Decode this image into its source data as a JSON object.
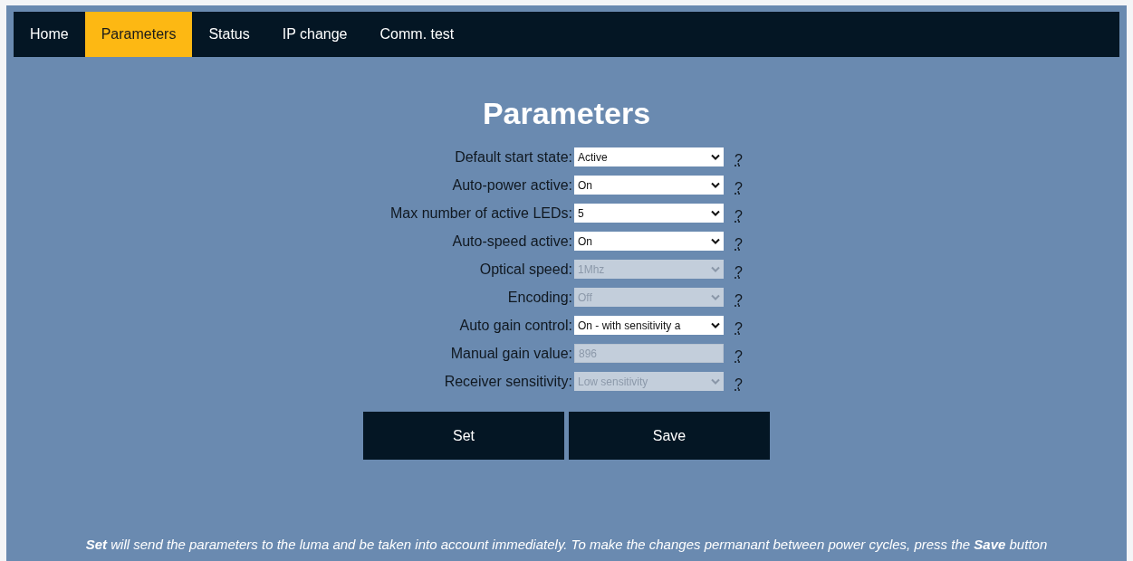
{
  "nav": [
    {
      "label": "Home",
      "selected": false
    },
    {
      "label": "Parameters",
      "selected": true
    },
    {
      "label": "Status",
      "selected": false
    },
    {
      "label": "IP change",
      "selected": false
    },
    {
      "label": "Comm. test",
      "selected": false
    }
  ],
  "title": "Parameters",
  "fields": [
    {
      "label": "Default start state:",
      "kind": "select",
      "value": "Active",
      "disabled": false,
      "help": "?"
    },
    {
      "label": "Auto-power active:",
      "kind": "select",
      "value": "On",
      "disabled": false,
      "help": "?"
    },
    {
      "label": "Max number of active LEDs:",
      "kind": "select",
      "value": "5",
      "disabled": false,
      "help": "?"
    },
    {
      "label": "Auto-speed active:",
      "kind": "select",
      "value": "On",
      "disabled": false,
      "help": "?"
    },
    {
      "label": "Optical speed:",
      "kind": "select",
      "value": "1Mhz",
      "disabled": true,
      "help": "?"
    },
    {
      "label": "Encoding:",
      "kind": "select",
      "value": "Off",
      "disabled": true,
      "help": "?"
    },
    {
      "label": "Auto gain control:",
      "kind": "select",
      "value": "On - with sensitivity a",
      "disabled": false,
      "help": "?"
    },
    {
      "label": "Manual gain value:",
      "kind": "input",
      "value": "896",
      "disabled": true,
      "help": "?"
    },
    {
      "label": "Receiver sensitivity:",
      "kind": "select",
      "value": "Low sensitivity",
      "disabled": true,
      "help": "?"
    }
  ],
  "buttons": [
    "Set",
    "Save"
  ],
  "footer": "**Set** will send the parameters to the luma and be taken into account immediately. To make the changes permanant between power cycles, press the **Save** button"
}
